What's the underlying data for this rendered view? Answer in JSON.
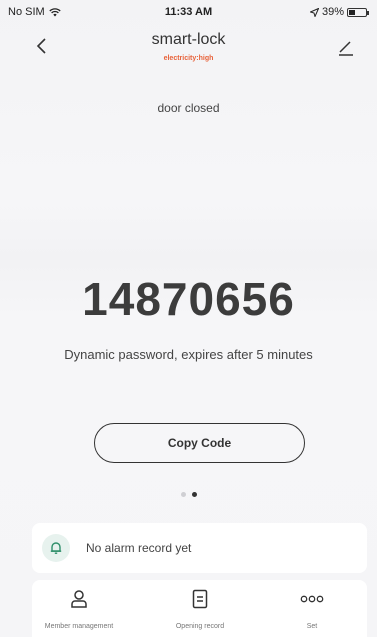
{
  "status_bar": {
    "carrier": "No SIM",
    "time": "11:33 AM",
    "battery_percent": "39%",
    "battery_level": 0.39,
    "icons": [
      "wifi-icon",
      "location-icon",
      "battery-icon"
    ]
  },
  "header": {
    "title": "smart-lock",
    "subtitle": "electricity:high",
    "subtitle_color": "#e8623a",
    "icons": [
      "back-chevron-icon",
      "edit-pencil-icon"
    ]
  },
  "door_status": "door closed",
  "password": {
    "code": "14870656",
    "description": "Dynamic password, expires after 5 minutes",
    "copy_label": "Copy Code"
  },
  "pager": {
    "pages": 2,
    "active": 2
  },
  "alarm": {
    "text": "No alarm record yet",
    "icon": "bell-icon",
    "accent": "#2f8f6a"
  },
  "nav": {
    "items": [
      {
        "label": "Member management",
        "icon": "person-icon"
      },
      {
        "label": "Opening record",
        "icon": "document-icon"
      },
      {
        "label": "Set",
        "icon": "more-dots-icon"
      }
    ]
  }
}
